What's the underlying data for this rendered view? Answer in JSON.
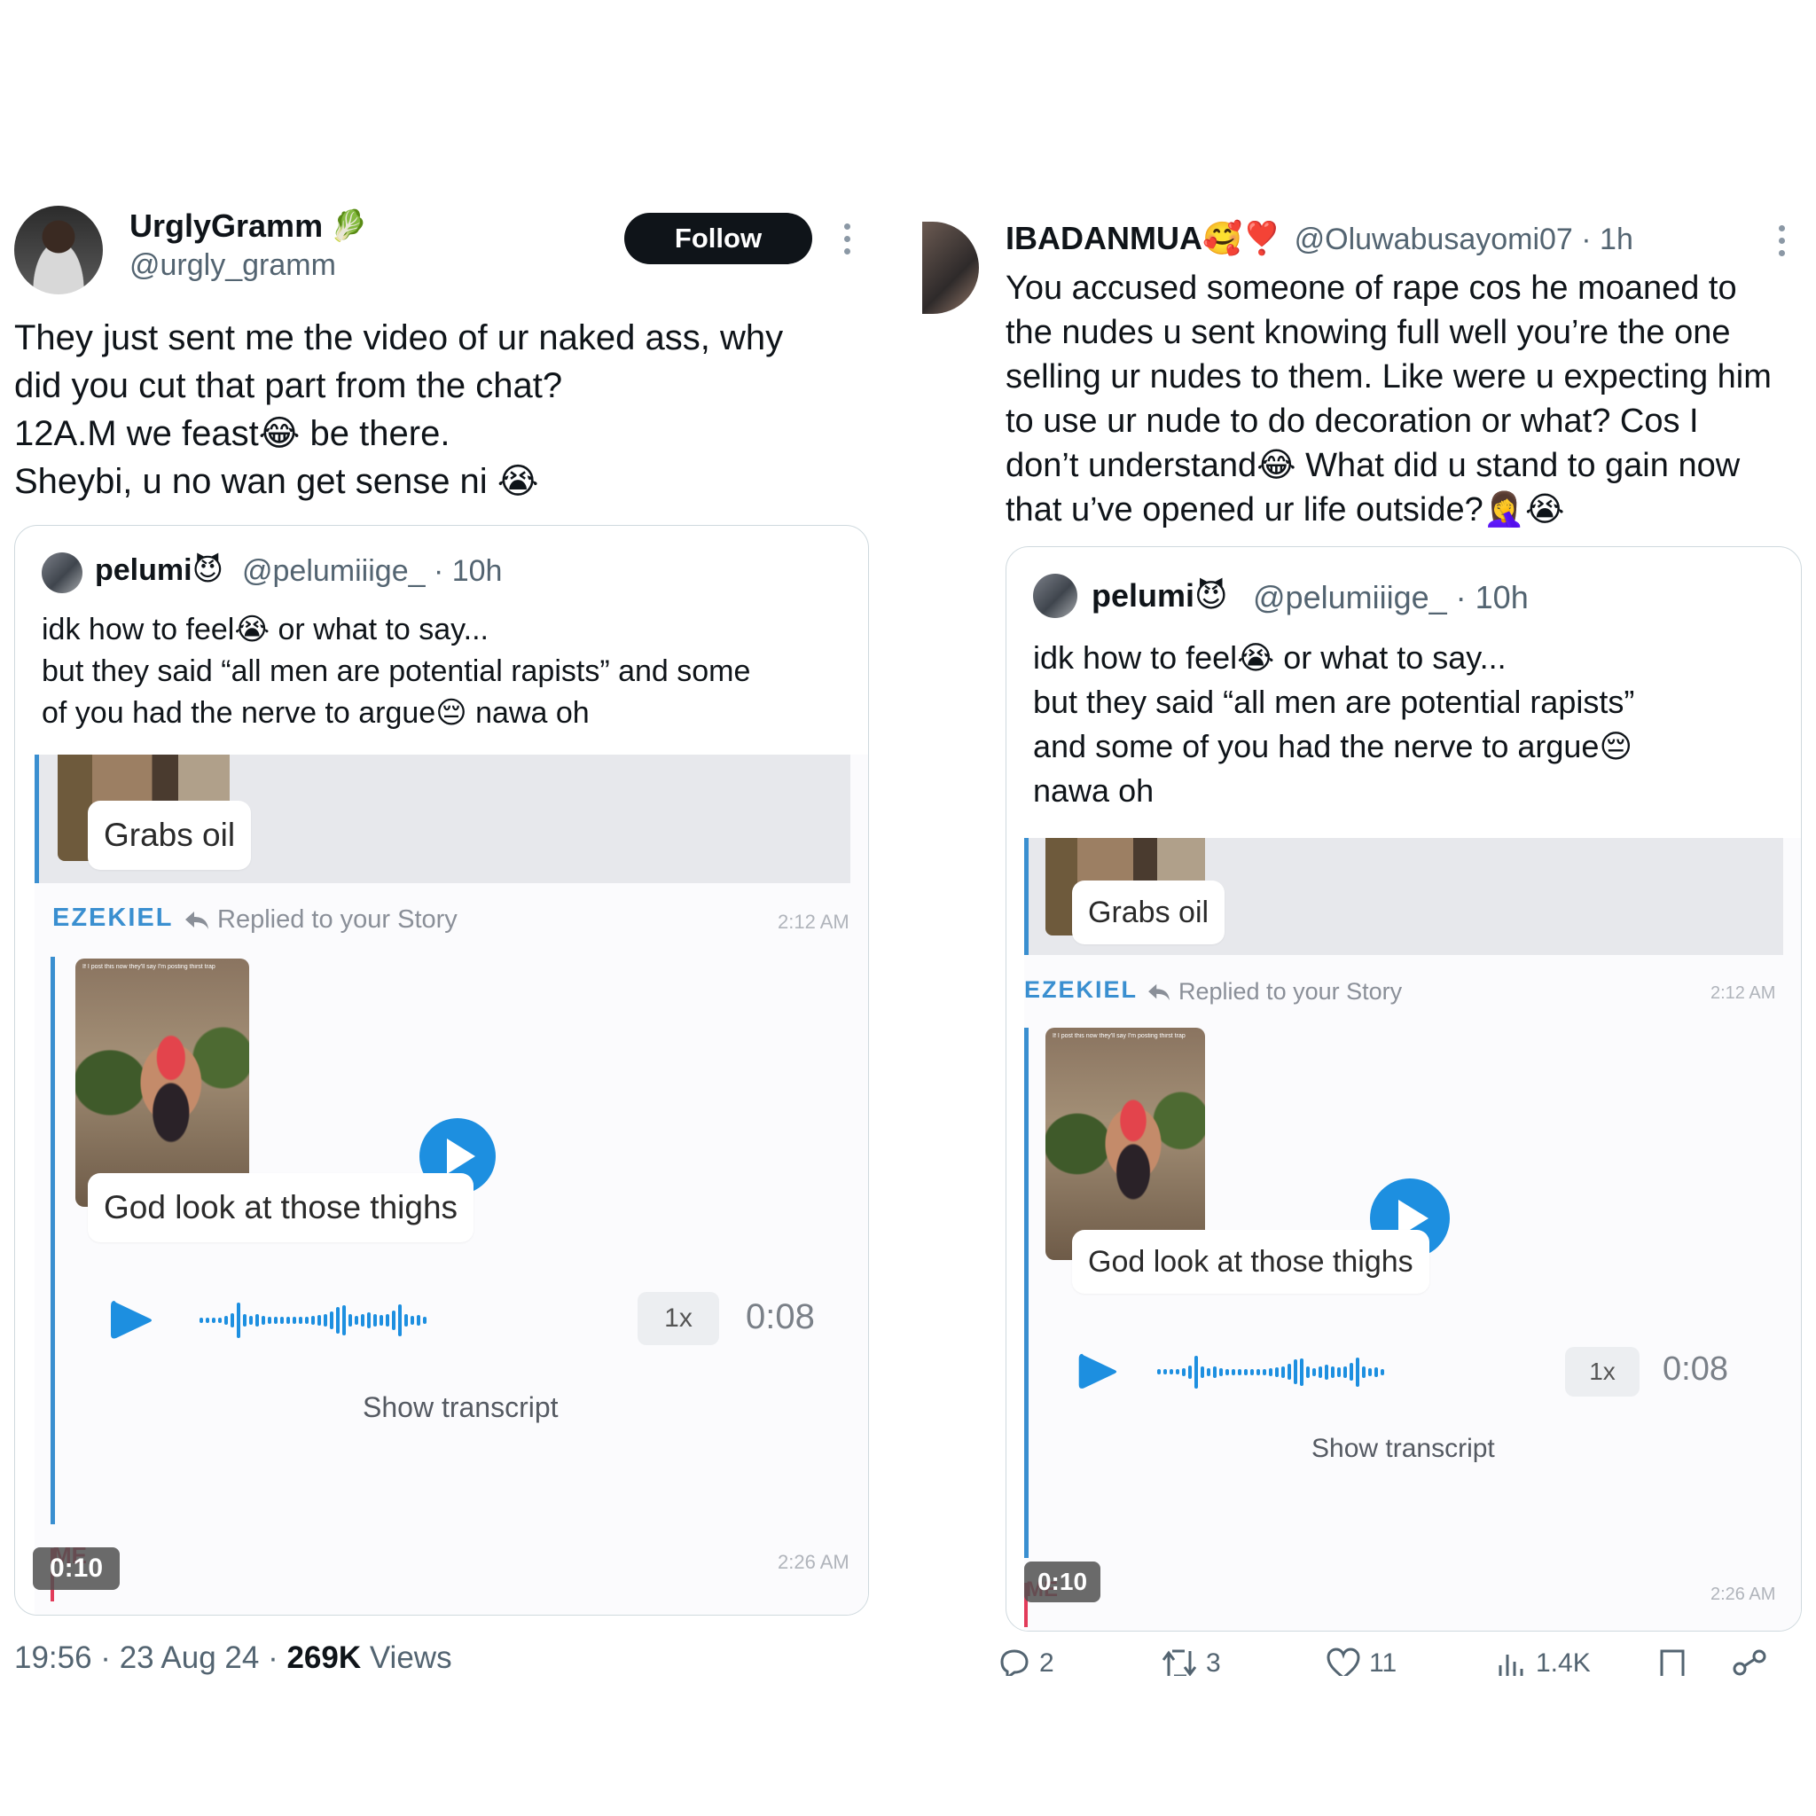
{
  "left": {
    "author": {
      "name": "UrglyGramm",
      "emoji": "🥬",
      "handle": "@urgly_gramm"
    },
    "follow_label": "Follow",
    "text": "They just sent me the video of ur naked ass, why\ndid you cut that part from the chat?\n12A.M we feast😂 be there.\nSheybi, u no wan get sense ni 😭",
    "quote": {
      "name": "pelumi😈",
      "meta": "@pelumiiige_ · 10h",
      "text": "idk how to feel😭 or what to say...\nbut they said “all men are potential rapists” and some\nof you had the nerve to argue😔 nawa oh",
      "snap": {
        "bubble1": "Grabs oil",
        "sender": "EZEKIEL",
        "replied": "Replied to your Story",
        "time1": "2:12 AM",
        "story_caption": "If I post this now they'll say I'm posting thirst trap",
        "bubble2": "God look at those thighs",
        "speed": "1x",
        "duration": "0:08",
        "transcript": "Show transcript",
        "me_label": "ME",
        "time2": "2:26 AM",
        "video_time": "0:10"
      }
    },
    "footer": {
      "time": "19:56 · 23 Aug 24 · ",
      "views_count": "269K",
      "views_label": " Views"
    }
  },
  "right": {
    "author": {
      "name": "IBADANMUA🥰❣️",
      "handle_time": "@Oluwabusayomi07 · 1h"
    },
    "text": "You accused  someone of rape cos he moaned to\nthe nudes u sent knowing full well you’re the one\nselling ur nudes to them. Like were u expecting him\nto use ur nude to do decoration or what? Cos I\ndon’t understand😂 What did u stand to gain now\nthat u’ve opened ur life outside?🤦‍♀️😭",
    "quote": {
      "name": "pelumi😈",
      "meta": "@pelumiiige_ · 10h",
      "text": "idk how to feel😭 or what to say...\nbut they said “all men are potential rapists”\nand some of you had the nerve to argue😔\nnawa oh",
      "snap": {
        "bubble1": "Grabs oil",
        "sender": "EZEKIEL",
        "replied": "Replied to your Story",
        "time1": "2:12 AM",
        "story_caption": "If I post this now they'll say I'm posting thirst trap",
        "bubble2": "God look at those thighs",
        "speed": "1x",
        "duration": "0:08",
        "transcript": "Show transcript",
        "me_label": "ME",
        "time2": "2:26 AM",
        "video_time": "0:10"
      }
    },
    "actions": {
      "replies": "2",
      "reposts": "3",
      "likes": "11",
      "views": "1.4K"
    }
  },
  "colors": {
    "accent_blue": "#1d8fe0",
    "snap_blue": "#3a8fd0",
    "text": "#0f1419",
    "muted": "#536471"
  },
  "icons": [
    "verified-leaf-icon",
    "more-icon",
    "play-icon",
    "reply-arrow-icon",
    "reply-icon",
    "repost-icon",
    "like-icon",
    "views-icon",
    "bookmark-icon",
    "share-icon"
  ]
}
